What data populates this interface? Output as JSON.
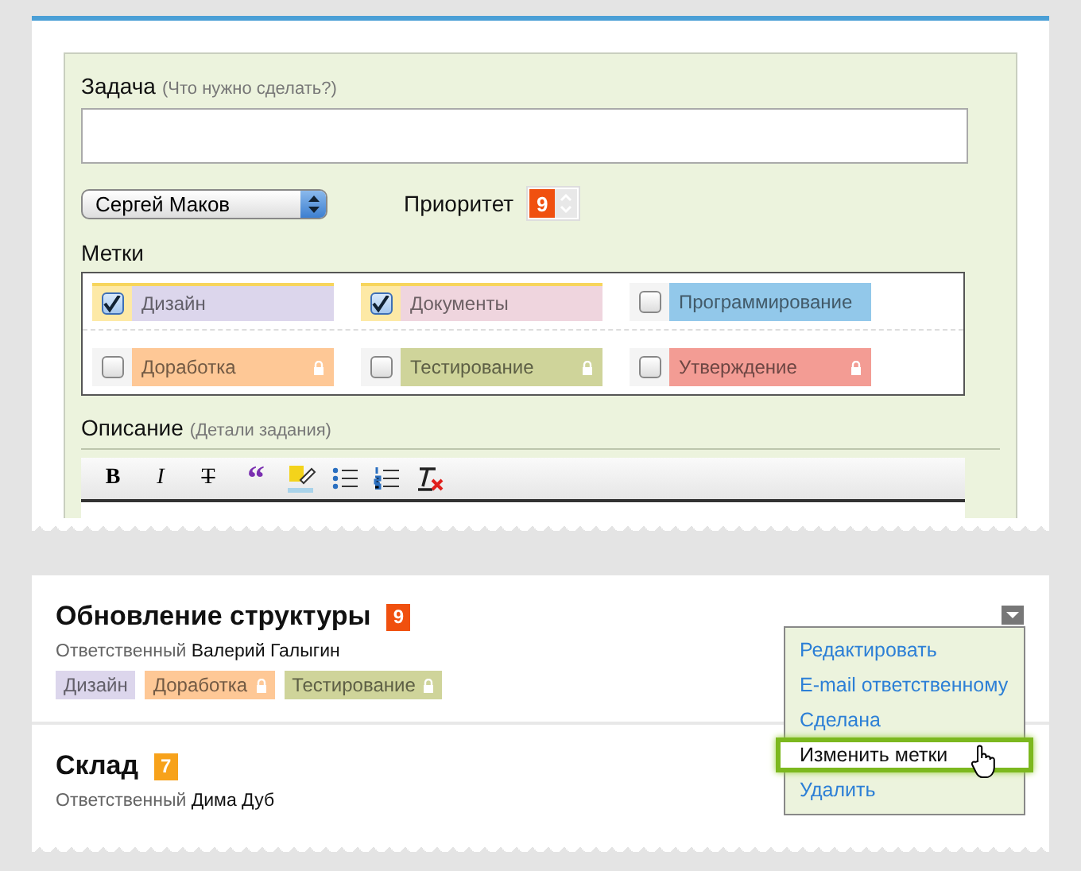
{
  "form": {
    "task_label": "Задача",
    "task_hint": "(Что нужно сделать?)",
    "assignee": "Сергей Маков",
    "priority_label": "Приоритет",
    "priority": "9",
    "tags_label": "Метки",
    "tags": [
      {
        "label": "Дизайн",
        "checked": true,
        "locked": false,
        "color": "#dcd6ec"
      },
      {
        "label": "Документы",
        "checked": true,
        "locked": false,
        "color": "#efd5de"
      },
      {
        "label": "Программирование",
        "checked": false,
        "locked": false,
        "color": "#92c8ea"
      },
      {
        "label": "Доработка",
        "checked": false,
        "locked": true,
        "color": "#fec896"
      },
      {
        "label": "Тестирование",
        "checked": false,
        "locked": true,
        "color": "#cfd49a"
      },
      {
        "label": "Утверждение",
        "checked": false,
        "locked": true,
        "color": "#f39c94"
      }
    ],
    "description_label": "Описание",
    "description_hint": "(Детали задания)",
    "toolbar": [
      {
        "kind": "bold",
        "label": "B"
      },
      {
        "kind": "italic",
        "label": "I"
      },
      {
        "kind": "strike",
        "label": "T"
      },
      {
        "kind": "quote",
        "label": "“"
      },
      {
        "kind": "highlight"
      },
      {
        "kind": "bullets"
      },
      {
        "kind": "numbers"
      },
      {
        "kind": "clear"
      }
    ]
  },
  "tasks": [
    {
      "title": "Обновление структуры",
      "priority": "9",
      "color": "#f0500f",
      "responsible_label": "Ответственный",
      "responsible": "Валерий Галыгин",
      "tags": [
        {
          "label": "Дизайн",
          "locked": false,
          "color": "#dcd6ec"
        },
        {
          "label": "Доработка",
          "locked": true,
          "color": "#fec896"
        },
        {
          "label": "Тестирование",
          "locked": true,
          "color": "#cfd49a"
        }
      ]
    },
    {
      "title": "Склад",
      "priority": "7",
      "color": "#f7a21b",
      "responsible_label": "Ответственный",
      "responsible": "Дима Дуб"
    }
  ],
  "menu": {
    "items": [
      {
        "label": "Редактировать",
        "selected": false
      },
      {
        "label": "E-mail ответственному",
        "selected": false
      },
      {
        "label": "Сделана",
        "selected": false
      },
      {
        "label": "Изменить метки",
        "selected": true
      },
      {
        "label": "Удалить",
        "selected": false
      }
    ]
  }
}
